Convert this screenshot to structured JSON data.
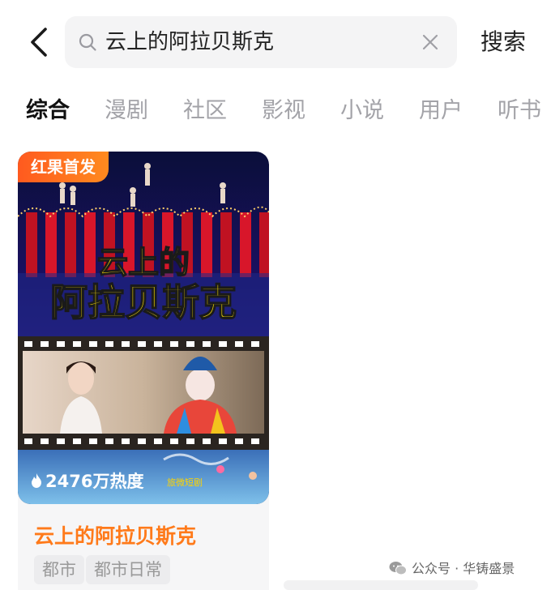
{
  "search": {
    "query": "云上的阿拉贝斯克",
    "button_label": "搜索"
  },
  "tabs": [
    {
      "label": "综合",
      "active": true
    },
    {
      "label": "漫剧",
      "active": false
    },
    {
      "label": "社区",
      "active": false
    },
    {
      "label": "影视",
      "active": false
    },
    {
      "label": "小说",
      "active": false
    },
    {
      "label": "用户",
      "active": false
    },
    {
      "label": "听书",
      "active": false
    }
  ],
  "result": {
    "badge": "红果首发",
    "heat": "2476万热度",
    "poster_watermark": "旅微短剧",
    "poster_title_line1": "云上的",
    "poster_title_line2": "阿拉贝斯克",
    "title": "云上的阿拉贝斯克",
    "tags": [
      "都市",
      "都市日常"
    ]
  },
  "footer": {
    "watermark": "公众号 · 华铸盛景"
  },
  "colors": {
    "accent": "#ff7a1a",
    "badge": "#ff5a1f",
    "tab_active": "#111111",
    "tab_inactive": "#a3a3a8"
  }
}
